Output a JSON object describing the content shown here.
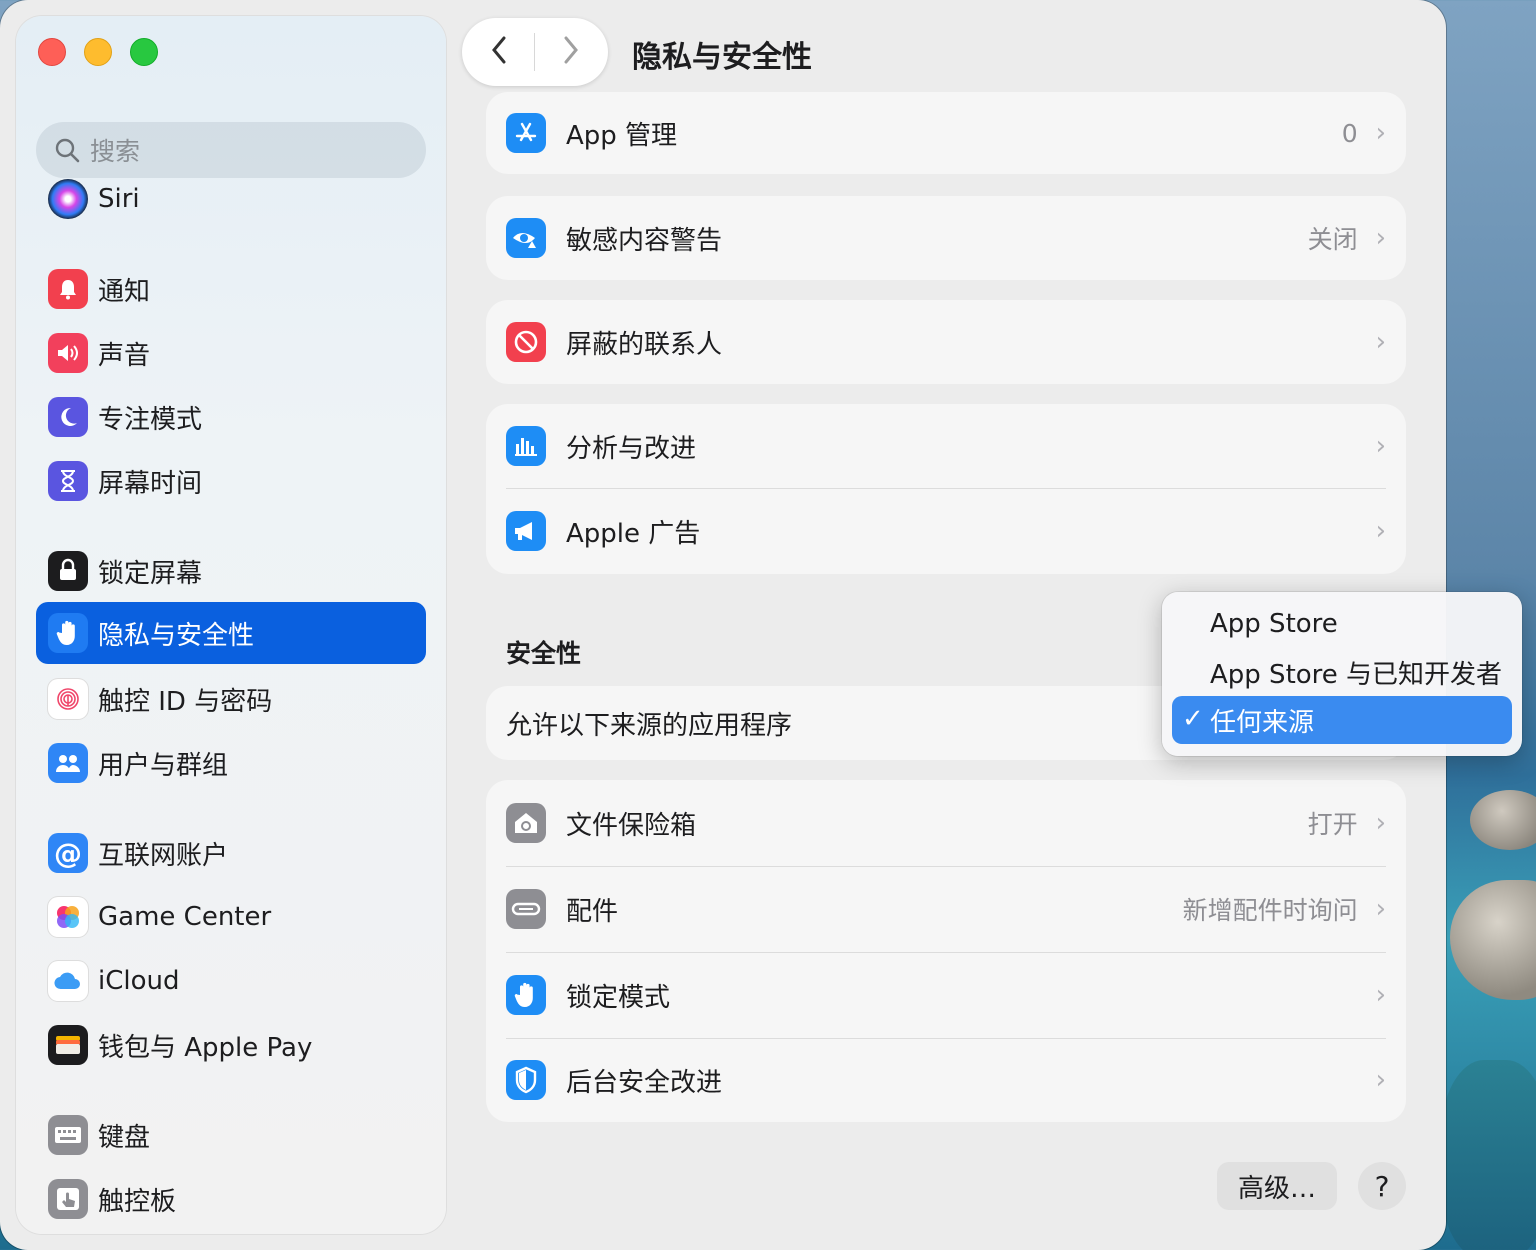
{
  "window": {
    "title": "隐私与安全性"
  },
  "search": {
    "placeholder": "搜索"
  },
  "sidebar": {
    "items": [
      {
        "label": "Siri",
        "icon": "siri-icon"
      },
      {
        "label": "通知",
        "icon": "bell-icon"
      },
      {
        "label": "声音",
        "icon": "speaker-icon"
      },
      {
        "label": "专注模式",
        "icon": "moon-icon"
      },
      {
        "label": "屏幕时间",
        "icon": "hourglass-icon"
      },
      {
        "label": "锁定屏幕",
        "icon": "lock-icon"
      },
      {
        "label": "隐私与安全性",
        "icon": "hand-icon",
        "selected": true
      },
      {
        "label": "触控 ID 与密码",
        "icon": "fingerprint-icon"
      },
      {
        "label": "用户与群组",
        "icon": "users-icon"
      },
      {
        "label": "互联网账户",
        "icon": "at-icon"
      },
      {
        "label": "Game Center",
        "icon": "game-center-icon"
      },
      {
        "label": "iCloud",
        "icon": "cloud-icon"
      },
      {
        "label": "钱包与 Apple Pay",
        "icon": "wallet-icon"
      },
      {
        "label": "键盘",
        "icon": "keyboard-icon"
      },
      {
        "label": "触控板",
        "icon": "trackpad-icon"
      }
    ]
  },
  "main": {
    "rows": {
      "app_management": {
        "label": "App 管理",
        "value": "0"
      },
      "sensitive_content": {
        "label": "敏感内容警告",
        "value": "关闭"
      },
      "blocked_contacts": {
        "label": "屏蔽的联系人"
      },
      "analytics": {
        "label": "分析与改进"
      },
      "apple_ads": {
        "label": "Apple 广告"
      }
    },
    "security": {
      "title": "安全性",
      "allow_apps_label": "允许以下来源的应用程序",
      "popup_options": [
        "App Store",
        "App Store 与已知开发者",
        "任何来源"
      ],
      "selected_option": "任何来源"
    },
    "rows2": {
      "filevault": {
        "label": "文件保险箱",
        "value": "打开"
      },
      "accessories": {
        "label": "配件",
        "value": "新增配件时询问"
      },
      "lockdown": {
        "label": "锁定模式"
      },
      "background_security": {
        "label": "后台安全改进"
      }
    },
    "buttons": {
      "advanced": "高级…",
      "help": "?"
    }
  },
  "colors": {
    "accent": "#0a60df",
    "selected_popup": "#3a8bf0"
  }
}
